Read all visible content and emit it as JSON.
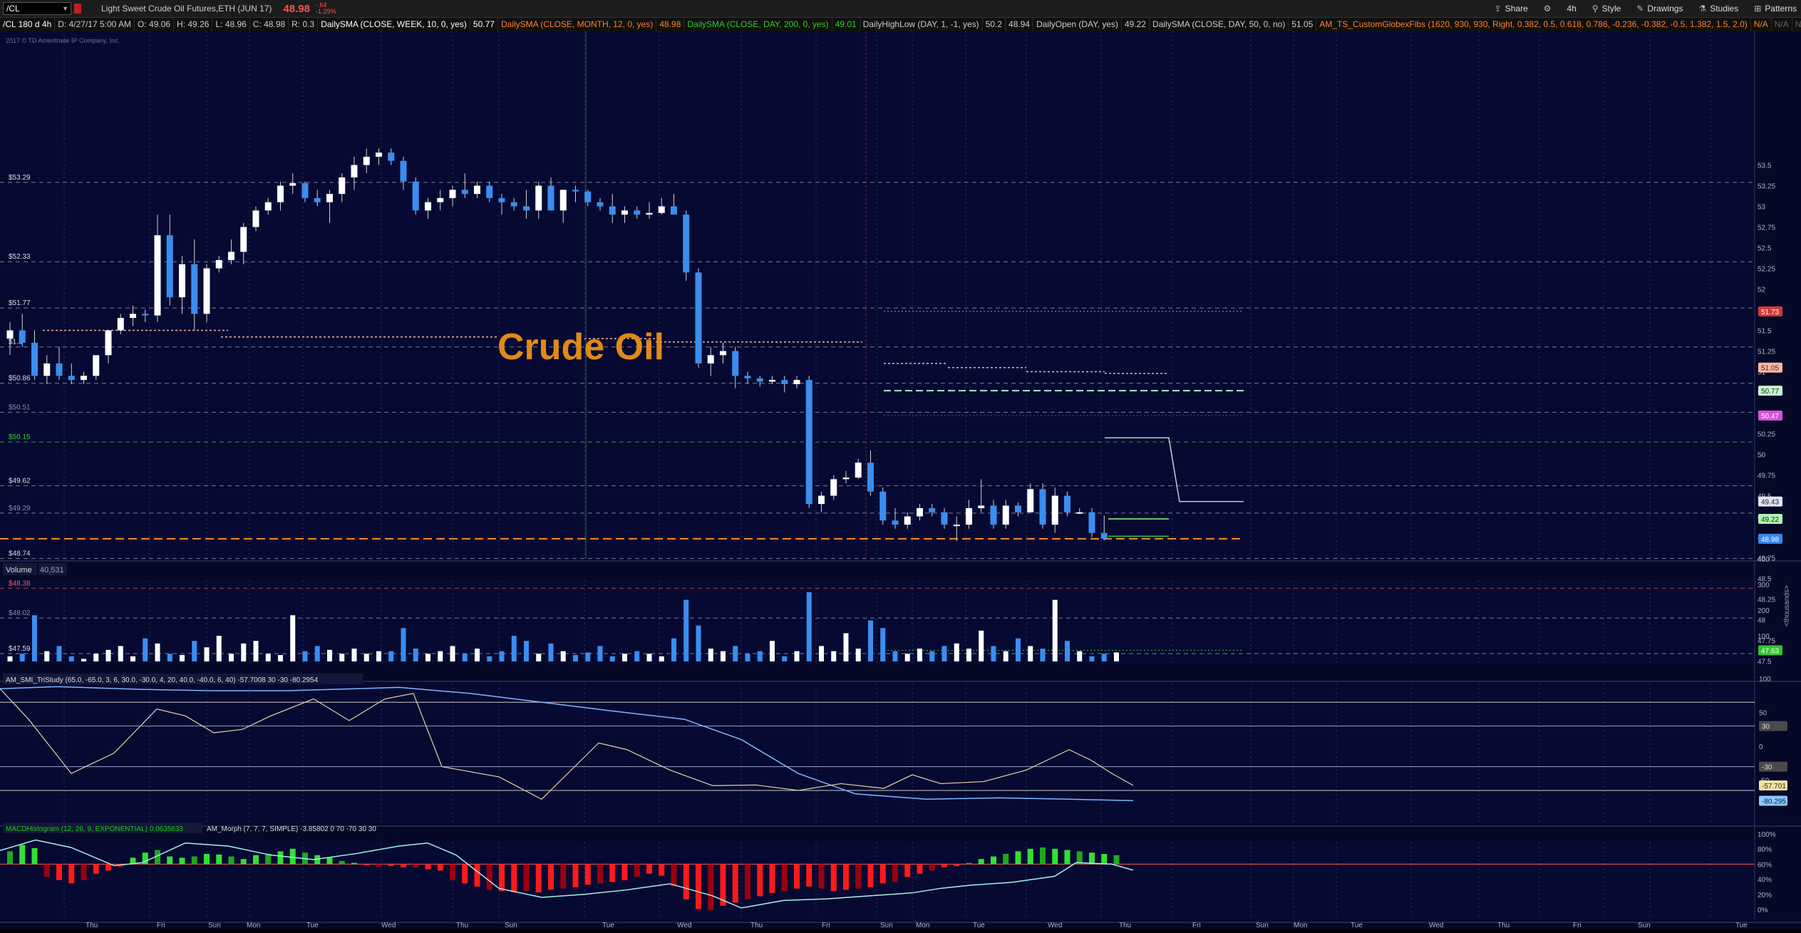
{
  "topbar": {
    "symbol": "/CL",
    "description": "Light Sweet Crude Oil Futures,ETH (JUN 17)",
    "last": "48.98",
    "change": "-.64",
    "change_pct": "-1.29%",
    "tools": [
      {
        "name": "share",
        "label": "Share",
        "icon": "share-icon"
      },
      {
        "name": "settings",
        "label": "",
        "icon": "gear-icon"
      },
      {
        "name": "timeframe",
        "label": "4h",
        "icon": ""
      },
      {
        "name": "style",
        "label": "Style",
        "icon": "style-icon"
      },
      {
        "name": "drawings",
        "label": "Drawings",
        "icon": "pencil-icon"
      },
      {
        "name": "studies",
        "label": "Studies",
        "icon": "flask-icon"
      },
      {
        "name": "patterns",
        "label": "Patterns",
        "icon": "patterns-icon"
      }
    ]
  },
  "studybar": [
    {
      "text": "/CL 180 d 4h",
      "color": "#ffffff"
    },
    {
      "text": "D: 4/27/17 5:00 AM",
      "color": "#cccccc"
    },
    {
      "text": "O: 49.06",
      "color": "#cccccc"
    },
    {
      "text": "H: 49.26",
      "color": "#cccccc"
    },
    {
      "text": "L: 48.96",
      "color": "#cccccc"
    },
    {
      "text": "C: 48.98",
      "color": "#cccccc"
    },
    {
      "text": "R: 0.3",
      "color": "#cccccc"
    },
    {
      "text": "DailySMA (CLOSE, WEEK, 10, 0, yes)",
      "color": "#ffffff"
    },
    {
      "text": "50.77",
      "color": "#ffffff"
    },
    {
      "text": "DailySMA (CLOSE, MONTH, 12, 0, yes)",
      "color": "#ff8030"
    },
    {
      "text": "48.98",
      "color": "#ff8030"
    },
    {
      "text": "DailySMA (CLOSE, DAY, 200, 0, yes)",
      "color": "#33cc33"
    },
    {
      "text": "49.01",
      "color": "#33cc33"
    },
    {
      "text": "DailyHighLow (DAY, 1, -1, yes)",
      "color": "#cccccc"
    },
    {
      "text": "50.2",
      "color": "#cccccc"
    },
    {
      "text": "48.94",
      "color": "#cccccc"
    },
    {
      "text": "DailyOpen (DAY, yes)",
      "color": "#cccccc"
    },
    {
      "text": "49.22",
      "color": "#cccccc"
    },
    {
      "text": "DailySMA (CLOSE, DAY, 50, 0, no)",
      "color": "#cccccc"
    },
    {
      "text": "51.05",
      "color": "#cccccc"
    },
    {
      "text": "AM_TS_CustomGlobexFibs (1620, 930, 930, Right, 0.382, 0.5, 0.618, 0.786, -0.236, -0.382, -0.5, 1.382, 1.5, 2.0)",
      "color": "#ff8030"
    },
    {
      "text": "N/A",
      "color": "#ff8030"
    },
    {
      "text": "N/A",
      "color": "#666666"
    },
    {
      "text": "N/A",
      "color": "#666666"
    },
    {
      "text": "N/A",
      "color": "#666666"
    },
    {
      "text": "N/A",
      "color": "#666666"
    },
    {
      "text": "N/A",
      "color": "#666666"
    },
    {
      "text": "N/A",
      "color": "#666666"
    }
  ],
  "price_panel": {
    "watermark": "2017 © TD Ameritrade IP Company, Inc.",
    "annotation": "Crude Oil",
    "right_axis_ticks": [
      "53.5",
      "53.25",
      "53",
      "52.75",
      "52.5",
      "52.25",
      "52",
      "51.75",
      "51.5",
      "51.25",
      "51",
      "50.75",
      "50.5",
      "50.25",
      "50",
      "49.75",
      "49.5",
      "49.25",
      "49",
      "48.75",
      "48.5",
      "48.25",
      "48",
      "47.75",
      "47.5"
    ],
    "left_levels": [
      {
        "label": "$53.29",
        "price": 53.29,
        "color": "#dddddd",
        "line": "#7a7f99"
      },
      {
        "label": "$52.33",
        "price": 52.33,
        "color": "#dddddd",
        "line": "#7a7f99"
      },
      {
        "label": "$51.77",
        "price": 51.77,
        "color": "#dddddd",
        "line": "#7a7f99"
      },
      {
        "label": "$1.3",
        "price": 51.3,
        "color": "#dddddd",
        "line": "#7a7f99"
      },
      {
        "label": "$50.86",
        "price": 50.86,
        "color": "#dddddd",
        "line": "#7a7f99"
      },
      {
        "label": "$50.51",
        "price": 50.51,
        "color": "#8a8fa8",
        "line": "#7a7f99"
      },
      {
        "label": "$50.15",
        "price": 50.15,
        "color": "#36c936",
        "line": "#2f9a2f"
      },
      {
        "label": "$49.62",
        "price": 49.62,
        "color": "#dddddd",
        "line": "#7a7f99"
      },
      {
        "label": "$49.29",
        "price": 49.29,
        "color": "#8a8fa8",
        "line": "#7a7f99"
      },
      {
        "label": "$48.74",
        "price": 48.74,
        "color": "#dddddd",
        "line": "#7a7f99"
      },
      {
        "label": "$48.38",
        "price": 48.38,
        "color": "#ff5a5a",
        "line": "#b34040"
      },
      {
        "label": "$48.02",
        "price": 48.02,
        "color": "#8a8fa8",
        "line": "#7a7f99"
      },
      {
        "label": "$47.59",
        "price": 47.59,
        "color": "#dddddd",
        "line": "#7a7f99"
      }
    ],
    "right_badges": [
      {
        "text": "51.73",
        "price": 51.73,
        "bg": "#d43a3a",
        "fg": "#ffffff"
      },
      {
        "text": "51.05",
        "price": 51.05,
        "bg": "#f3b8a6",
        "fg": "#7a1a00"
      },
      {
        "text": "50.77",
        "price": 50.77,
        "bg": "#c6f2d4",
        "fg": "#004010"
      },
      {
        "text": "50.47",
        "price": 50.47,
        "bg": "#d94fd9",
        "fg": "#ffffff"
      },
      {
        "text": "49.43",
        "price": 49.43,
        "bg": "#e3e3f2",
        "fg": "#202040"
      },
      {
        "text": "49.22",
        "price": 49.22,
        "bg": "#b2f2b2",
        "fg": "#004000"
      },
      {
        "text": "48.98",
        "price": 48.98,
        "bg": "#3a86f0",
        "fg": "#ffffff"
      },
      {
        "text": "47.63",
        "price": 47.63,
        "bg": "#33c433",
        "fg": "#ffffff"
      }
    ]
  },
  "volume_panel": {
    "label": "Volume",
    "value": "40,531",
    "right_axis_ticks": [
      "400",
      "300",
      "200",
      "100"
    ],
    "unit_label": "<thousands>"
  },
  "smi_panel": {
    "label": "AM_SMI_TriStudy (65.0, -65.0, 3, 6, 30.0, -30.0, 4, 20, 40.0, -40.0, 6, 40)",
    "values": [
      "-57.7008",
      "30",
      "-30",
      "-80.2954"
    ],
    "right_axis_ticks": [
      "100",
      "50",
      "0",
      "-50"
    ],
    "right_badges": [
      {
        "text": "30",
        "bg": "#4a4a4a",
        "fg": "#dddddd"
      },
      {
        "text": "-30",
        "bg": "#4a4a4a",
        "fg": "#dddddd"
      },
      {
        "text": "-57.701",
        "bg": "#f2e2a4",
        "fg": "#303000"
      },
      {
        "text": "-80.295",
        "bg": "#8cc8ff",
        "fg": "#002040"
      }
    ]
  },
  "macd_panel": {
    "label1": "MACDHistogram (12, 26, 9, EXPONENTIAL)",
    "value1": "0.0635633",
    "label2": "AM_Morph (7, 7, 7, SIMPLE)",
    "values2": [
      "-3.85802",
      "0",
      "70",
      "-70",
      "30",
      "30"
    ],
    "right_axis_ticks": [
      "100%",
      "80%",
      "60%",
      "40%",
      "20%",
      "0%"
    ]
  },
  "x_axis": {
    "labels": [
      "Thu",
      "Fri",
      "Sun",
      "Mon",
      "Tue",
      "Wed",
      "Thu",
      "Sun",
      "Tue",
      "Wed",
      "Thu",
      "Fri",
      "Sun",
      "Mon",
      "Tue",
      "Wed",
      "Thu",
      "Fri",
      "Sun",
      "Mon",
      "Tue",
      "Wed",
      "Thu",
      "Fri",
      "Sun",
      "Tue"
    ]
  },
  "chart_data": {
    "type": "candlestick",
    "symbol": "/CL",
    "timeframe": "4h",
    "ylim": [
      47.45,
      53.6
    ],
    "candles": [
      [
        51.4,
        51.6,
        51.2,
        51.5
      ],
      [
        51.5,
        51.7,
        51.3,
        51.35
      ],
      [
        51.35,
        51.5,
        50.9,
        50.95
      ],
      [
        50.95,
        51.2,
        50.85,
        51.1
      ],
      [
        51.1,
        51.3,
        50.9,
        50.95
      ],
      [
        50.95,
        51.1,
        50.85,
        50.9
      ],
      [
        50.9,
        51.0,
        50.85,
        50.95
      ],
      [
        50.95,
        51.2,
        50.9,
        51.2
      ],
      [
        51.2,
        51.5,
        51.1,
        51.5
      ],
      [
        51.5,
        51.7,
        51.45,
        51.65
      ],
      [
        51.65,
        51.8,
        51.55,
        51.7
      ],
      [
        51.7,
        51.75,
        51.6,
        51.68
      ],
      [
        51.68,
        52.9,
        51.6,
        52.65
      ],
      [
        52.65,
        52.9,
        51.8,
        51.9
      ],
      [
        51.9,
        52.4,
        51.7,
        52.3
      ],
      [
        52.3,
        52.6,
        51.5,
        51.7
      ],
      [
        51.7,
        52.3,
        51.6,
        52.25
      ],
      [
        52.25,
        52.4,
        52.2,
        52.35
      ],
      [
        52.35,
        52.6,
        52.3,
        52.45
      ],
      [
        52.45,
        52.8,
        52.3,
        52.75
      ],
      [
        52.75,
        53.0,
        52.7,
        52.95
      ],
      [
        52.95,
        53.1,
        52.9,
        53.05
      ],
      [
        53.05,
        53.3,
        52.95,
        53.25
      ],
      [
        53.25,
        53.4,
        53.15,
        53.28
      ],
      [
        53.28,
        53.3,
        53.05,
        53.1
      ],
      [
        53.1,
        53.2,
        53.0,
        53.05
      ],
      [
        53.05,
        53.2,
        52.8,
        53.15
      ],
      [
        53.15,
        53.4,
        53.05,
        53.35
      ],
      [
        53.35,
        53.6,
        53.2,
        53.5
      ],
      [
        53.5,
        53.7,
        53.4,
        53.6
      ],
      [
        53.6,
        53.7,
        53.5,
        53.65
      ],
      [
        53.65,
        53.7,
        53.5,
        53.55
      ],
      [
        53.55,
        53.6,
        53.2,
        53.3
      ],
      [
        53.3,
        53.35,
        52.9,
        52.95
      ],
      [
        52.95,
        53.1,
        52.85,
        53.05
      ],
      [
        53.05,
        53.2,
        52.95,
        53.1
      ],
      [
        53.1,
        53.25,
        53.0,
        53.2
      ],
      [
        53.2,
        53.4,
        53.1,
        53.15
      ],
      [
        53.15,
        53.3,
        53.1,
        53.25
      ],
      [
        53.25,
        53.3,
        53.05,
        53.1
      ],
      [
        53.1,
        53.15,
        52.9,
        53.05
      ],
      [
        53.05,
        53.1,
        52.95,
        53.0
      ],
      [
        53.0,
        53.2,
        52.85,
        52.95
      ],
      [
        52.95,
        53.3,
        52.85,
        53.25
      ],
      [
        53.25,
        53.35,
        52.95,
        52.95
      ],
      [
        52.95,
        53.1,
        52.8,
        53.2
      ],
      [
        53.2,
        53.25,
        53.05,
        53.18
      ],
      [
        53.18,
        53.2,
        53.0,
        53.05
      ],
      [
        53.05,
        53.1,
        52.95,
        53.0
      ],
      [
        53.0,
        53.15,
        52.8,
        52.9
      ],
      [
        52.9,
        53.0,
        52.8,
        52.95
      ],
      [
        52.95,
        53.0,
        52.85,
        52.9
      ],
      [
        52.9,
        53.05,
        52.85,
        52.92
      ],
      [
        52.92,
        53.1,
        52.9,
        53.0
      ],
      [
        53.0,
        53.15,
        52.95,
        52.9
      ],
      [
        52.9,
        52.95,
        52.1,
        52.2
      ],
      [
        52.2,
        52.25,
        51.05,
        51.1
      ],
      [
        51.1,
        51.3,
        50.95,
        51.2
      ],
      [
        51.2,
        51.35,
        51.1,
        51.25
      ],
      [
        51.25,
        51.3,
        50.8,
        50.95
      ],
      [
        50.95,
        51.0,
        50.85,
        50.92
      ],
      [
        50.92,
        50.95,
        50.82,
        50.88
      ],
      [
        50.88,
        50.95,
        50.85,
        50.9
      ],
      [
        50.9,
        50.95,
        50.75,
        50.85
      ],
      [
        50.85,
        50.95,
        50.8,
        50.9
      ],
      [
        50.9,
        50.95,
        49.35,
        49.4
      ],
      [
        49.4,
        49.55,
        49.3,
        49.5
      ],
      [
        49.5,
        49.75,
        49.45,
        49.7
      ],
      [
        49.7,
        49.8,
        49.65,
        49.72
      ],
      [
        49.72,
        49.95,
        49.7,
        49.9
      ],
      [
        49.9,
        50.05,
        49.5,
        49.55
      ],
      [
        49.55,
        49.6,
        49.15,
        49.2
      ],
      [
        49.2,
        49.35,
        49.1,
        49.15
      ],
      [
        49.15,
        49.3,
        49.1,
        49.25
      ],
      [
        49.25,
        49.4,
        49.2,
        49.35
      ],
      [
        49.35,
        49.4,
        49.25,
        49.3
      ],
      [
        49.3,
        49.35,
        49.1,
        49.15
      ],
      [
        49.15,
        49.25,
        48.95,
        49.15
      ],
      [
        49.15,
        49.45,
        49.1,
        49.35
      ],
      [
        49.35,
        49.7,
        49.3,
        49.38
      ],
      [
        49.38,
        49.45,
        49.1,
        49.15
      ],
      [
        49.15,
        49.45,
        49.1,
        49.38
      ],
      [
        49.38,
        49.42,
        49.25,
        49.3
      ],
      [
        49.3,
        49.65,
        49.3,
        49.58
      ],
      [
        49.58,
        49.65,
        49.1,
        49.15
      ],
      [
        49.15,
        49.6,
        49.05,
        49.5
      ],
      [
        49.5,
        49.55,
        49.25,
        49.3
      ],
      [
        49.3,
        49.35,
        49.28,
        49.3
      ],
      [
        49.3,
        49.35,
        49.0,
        49.05
      ],
      [
        49.05,
        49.26,
        48.96,
        48.98
      ]
    ]
  }
}
